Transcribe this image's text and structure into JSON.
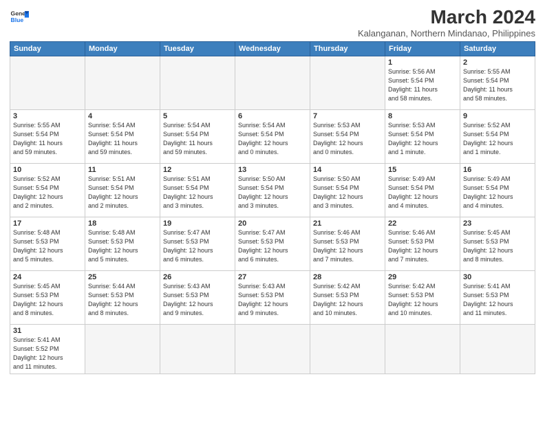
{
  "logo": {
    "line1": "General",
    "line2": "Blue"
  },
  "title": "March 2024",
  "subtitle": "Kalanganan, Northern Mindanao, Philippines",
  "weekdays": [
    "Sunday",
    "Monday",
    "Tuesday",
    "Wednesday",
    "Thursday",
    "Friday",
    "Saturday"
  ],
  "weeks": [
    [
      {
        "day": "",
        "info": ""
      },
      {
        "day": "",
        "info": ""
      },
      {
        "day": "",
        "info": ""
      },
      {
        "day": "",
        "info": ""
      },
      {
        "day": "",
        "info": ""
      },
      {
        "day": "1",
        "info": "Sunrise: 5:56 AM\nSunset: 5:54 PM\nDaylight: 11 hours\nand 58 minutes."
      },
      {
        "day": "2",
        "info": "Sunrise: 5:55 AM\nSunset: 5:54 PM\nDaylight: 11 hours\nand 58 minutes."
      }
    ],
    [
      {
        "day": "3",
        "info": "Sunrise: 5:55 AM\nSunset: 5:54 PM\nDaylight: 11 hours\nand 59 minutes."
      },
      {
        "day": "4",
        "info": "Sunrise: 5:54 AM\nSunset: 5:54 PM\nDaylight: 11 hours\nand 59 minutes."
      },
      {
        "day": "5",
        "info": "Sunrise: 5:54 AM\nSunset: 5:54 PM\nDaylight: 11 hours\nand 59 minutes."
      },
      {
        "day": "6",
        "info": "Sunrise: 5:54 AM\nSunset: 5:54 PM\nDaylight: 12 hours\nand 0 minutes."
      },
      {
        "day": "7",
        "info": "Sunrise: 5:53 AM\nSunset: 5:54 PM\nDaylight: 12 hours\nand 0 minutes."
      },
      {
        "day": "8",
        "info": "Sunrise: 5:53 AM\nSunset: 5:54 PM\nDaylight: 12 hours\nand 1 minute."
      },
      {
        "day": "9",
        "info": "Sunrise: 5:52 AM\nSunset: 5:54 PM\nDaylight: 12 hours\nand 1 minute."
      }
    ],
    [
      {
        "day": "10",
        "info": "Sunrise: 5:52 AM\nSunset: 5:54 PM\nDaylight: 12 hours\nand 2 minutes."
      },
      {
        "day": "11",
        "info": "Sunrise: 5:51 AM\nSunset: 5:54 PM\nDaylight: 12 hours\nand 2 minutes."
      },
      {
        "day": "12",
        "info": "Sunrise: 5:51 AM\nSunset: 5:54 PM\nDaylight: 12 hours\nand 3 minutes."
      },
      {
        "day": "13",
        "info": "Sunrise: 5:50 AM\nSunset: 5:54 PM\nDaylight: 12 hours\nand 3 minutes."
      },
      {
        "day": "14",
        "info": "Sunrise: 5:50 AM\nSunset: 5:54 PM\nDaylight: 12 hours\nand 3 minutes."
      },
      {
        "day": "15",
        "info": "Sunrise: 5:49 AM\nSunset: 5:54 PM\nDaylight: 12 hours\nand 4 minutes."
      },
      {
        "day": "16",
        "info": "Sunrise: 5:49 AM\nSunset: 5:54 PM\nDaylight: 12 hours\nand 4 minutes."
      }
    ],
    [
      {
        "day": "17",
        "info": "Sunrise: 5:48 AM\nSunset: 5:53 PM\nDaylight: 12 hours\nand 5 minutes."
      },
      {
        "day": "18",
        "info": "Sunrise: 5:48 AM\nSunset: 5:53 PM\nDaylight: 12 hours\nand 5 minutes."
      },
      {
        "day": "19",
        "info": "Sunrise: 5:47 AM\nSunset: 5:53 PM\nDaylight: 12 hours\nand 6 minutes."
      },
      {
        "day": "20",
        "info": "Sunrise: 5:47 AM\nSunset: 5:53 PM\nDaylight: 12 hours\nand 6 minutes."
      },
      {
        "day": "21",
        "info": "Sunrise: 5:46 AM\nSunset: 5:53 PM\nDaylight: 12 hours\nand 7 minutes."
      },
      {
        "day": "22",
        "info": "Sunrise: 5:46 AM\nSunset: 5:53 PM\nDaylight: 12 hours\nand 7 minutes."
      },
      {
        "day": "23",
        "info": "Sunrise: 5:45 AM\nSunset: 5:53 PM\nDaylight: 12 hours\nand 8 minutes."
      }
    ],
    [
      {
        "day": "24",
        "info": "Sunrise: 5:45 AM\nSunset: 5:53 PM\nDaylight: 12 hours\nand 8 minutes."
      },
      {
        "day": "25",
        "info": "Sunrise: 5:44 AM\nSunset: 5:53 PM\nDaylight: 12 hours\nand 8 minutes."
      },
      {
        "day": "26",
        "info": "Sunrise: 5:43 AM\nSunset: 5:53 PM\nDaylight: 12 hours\nand 9 minutes."
      },
      {
        "day": "27",
        "info": "Sunrise: 5:43 AM\nSunset: 5:53 PM\nDaylight: 12 hours\nand 9 minutes."
      },
      {
        "day": "28",
        "info": "Sunrise: 5:42 AM\nSunset: 5:53 PM\nDaylight: 12 hours\nand 10 minutes."
      },
      {
        "day": "29",
        "info": "Sunrise: 5:42 AM\nSunset: 5:53 PM\nDaylight: 12 hours\nand 10 minutes."
      },
      {
        "day": "30",
        "info": "Sunrise: 5:41 AM\nSunset: 5:53 PM\nDaylight: 12 hours\nand 11 minutes."
      }
    ],
    [
      {
        "day": "31",
        "info": "Sunrise: 5:41 AM\nSunset: 5:52 PM\nDaylight: 12 hours\nand 11 minutes."
      },
      {
        "day": "",
        "info": ""
      },
      {
        "day": "",
        "info": ""
      },
      {
        "day": "",
        "info": ""
      },
      {
        "day": "",
        "info": ""
      },
      {
        "day": "",
        "info": ""
      },
      {
        "day": "",
        "info": ""
      }
    ]
  ]
}
